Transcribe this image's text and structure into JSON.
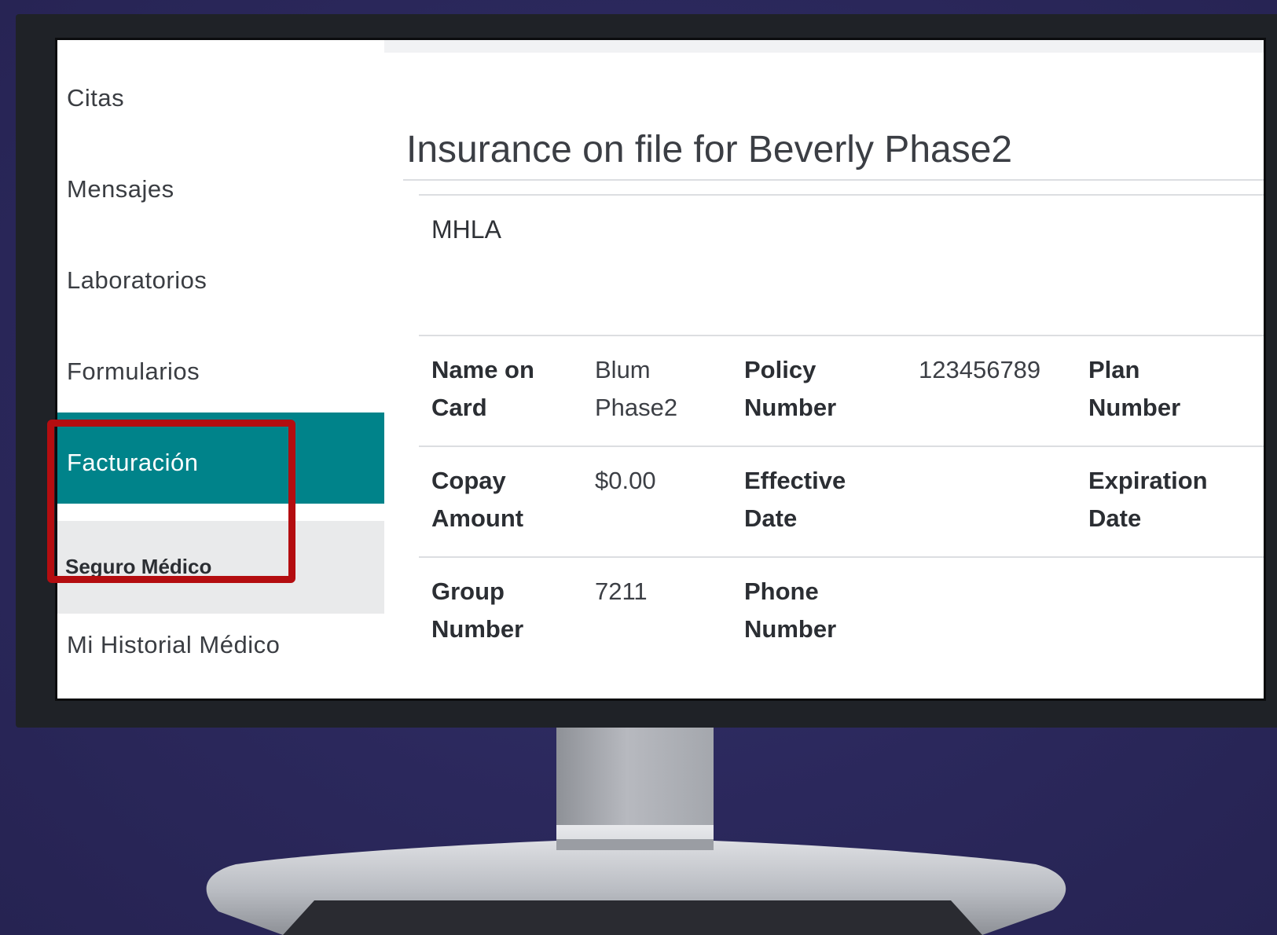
{
  "sidebar": {
    "items": [
      {
        "label": "Citas"
      },
      {
        "label": "Mensajes"
      },
      {
        "label": "Laboratorios"
      },
      {
        "label": "Formularios"
      },
      {
        "label": "Facturación"
      },
      {
        "label": "Mi Historial Médico"
      }
    ],
    "active_item": "Facturación",
    "subitems": [
      {
        "label": "Seguro Médico"
      }
    ]
  },
  "main": {
    "title": "Insurance on file for Beverly Phase2",
    "insurance": {
      "name": "MHLA",
      "fields": {
        "name_on_card": {
          "label": "Name on\nCard",
          "value": "Blum\nPhase2"
        },
        "policy_number": {
          "label": "Policy\nNumber",
          "value": "123456789"
        },
        "plan_number": {
          "label": "Plan\nNumber",
          "value": ""
        },
        "copay_amount": {
          "label": "Copay\nAmount",
          "value": "$0.00"
        },
        "effective_date": {
          "label": "Effective\nDate",
          "value": ""
        },
        "expiration_date": {
          "label": "Expiration\nDate",
          "value": ""
        },
        "group_number": {
          "label": "Group\nNumber",
          "value": "7211"
        },
        "phone_number": {
          "label": "Phone\nNumber",
          "value": ""
        }
      }
    }
  },
  "colors": {
    "active_nav_bg": "#00838a",
    "subnav_bg": "#e9eaeb",
    "highlight": "#b40d10",
    "background": "#2c2a5e"
  }
}
